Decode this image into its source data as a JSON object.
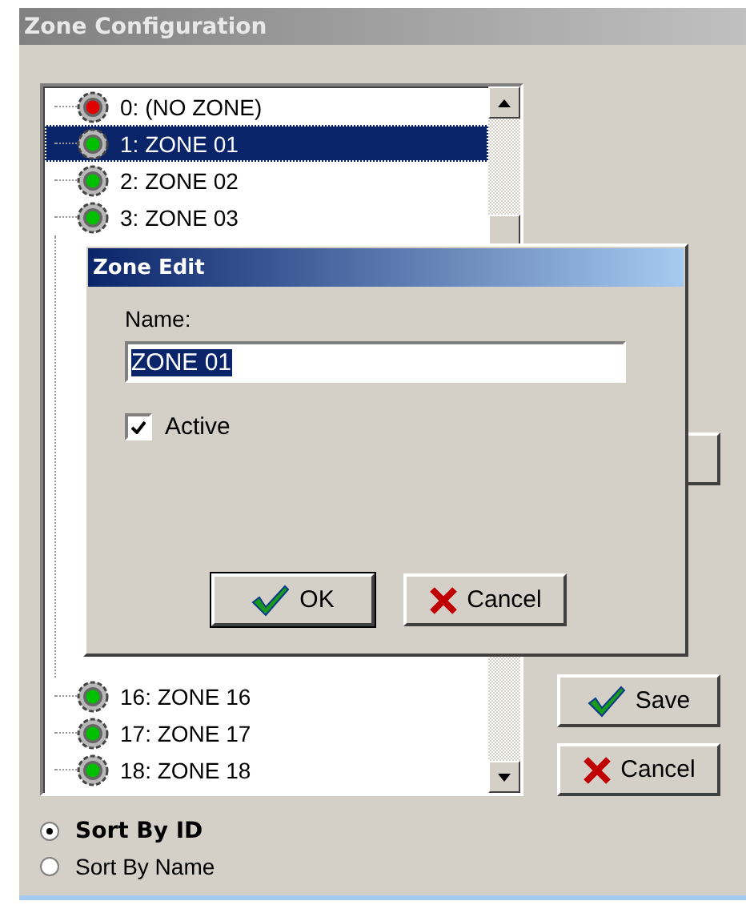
{
  "window": {
    "title": "Zone Configuration"
  },
  "zones": {
    "top_items": [
      {
        "label": "0: (NO ZONE)",
        "color": "#e00000",
        "selected": false
      },
      {
        "label": "1: ZONE 01",
        "color": "#00c000",
        "selected": true
      },
      {
        "label": "2: ZONE 02",
        "color": "#00c000",
        "selected": false
      },
      {
        "label": "3: ZONE 03",
        "color": "#00c000",
        "selected": false
      }
    ],
    "bottom_items": [
      {
        "label": "16: ZONE 16",
        "color": "#00c000",
        "selected": false
      },
      {
        "label": "17: ZONE 17",
        "color": "#00c000",
        "selected": false
      },
      {
        "label": "18: ZONE 18",
        "color": "#00c000",
        "selected": false
      }
    ]
  },
  "buttons": [
    {
      "label": "Save",
      "kind": "ok"
    },
    {
      "label": "Cancel",
      "kind": "cancel"
    }
  ],
  "sort_options": [
    {
      "label": "Sort By ID",
      "selected": true
    },
    {
      "label": "Sort By Name",
      "selected": false
    }
  ],
  "dialog": {
    "title": "Zone Edit",
    "name_label": "Name:",
    "name_value": "ZONE 01",
    "active": {
      "label": "Active",
      "checked": true
    },
    "buttons": [
      {
        "label": "OK",
        "kind": "ok"
      },
      {
        "label": "Cancel",
        "kind": "cancel"
      }
    ]
  }
}
